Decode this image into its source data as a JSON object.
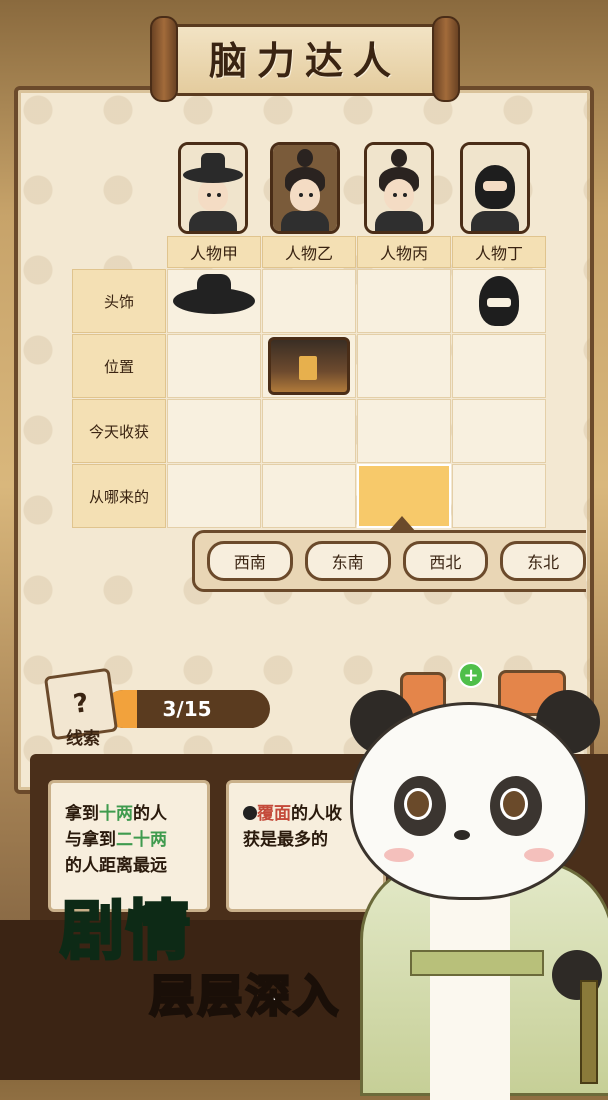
{
  "title": "脑力达人",
  "characters": [
    {
      "name": "人物甲",
      "icon": "bamboo-hat-person-icon"
    },
    {
      "name": "人物乙",
      "icon": "ponytail-person-icon"
    },
    {
      "name": "人物丙",
      "icon": "ponytail-person-icon"
    },
    {
      "name": "人物丁",
      "icon": "masked-person-icon"
    }
  ],
  "rows": [
    "头饰",
    "位置",
    "今天收获",
    "从哪来的"
  ],
  "options": [
    "西南",
    "东南",
    "西北",
    "东北"
  ],
  "progress": {
    "text": "3/15",
    "current": 3,
    "total": 15
  },
  "clue_label": "线索",
  "clues": {
    "card1": {
      "p1": "拿到",
      "h1": "十两",
      "p2": "的人",
      "p3": "与拿到",
      "h2": "二十两",
      "p4": "的人距离最远"
    },
    "card2": {
      "h1": "覆面",
      "p1": "的人收",
      "p2": "获是最多的"
    }
  },
  "banner": {
    "line1": "剧情",
    "line2": "层层深入"
  },
  "colors": {
    "accent": "#f2a23c",
    "highlight_green": "#3f9b4e",
    "board_border": "#6b4a2b",
    "banner_green": "#5fe8a1"
  }
}
